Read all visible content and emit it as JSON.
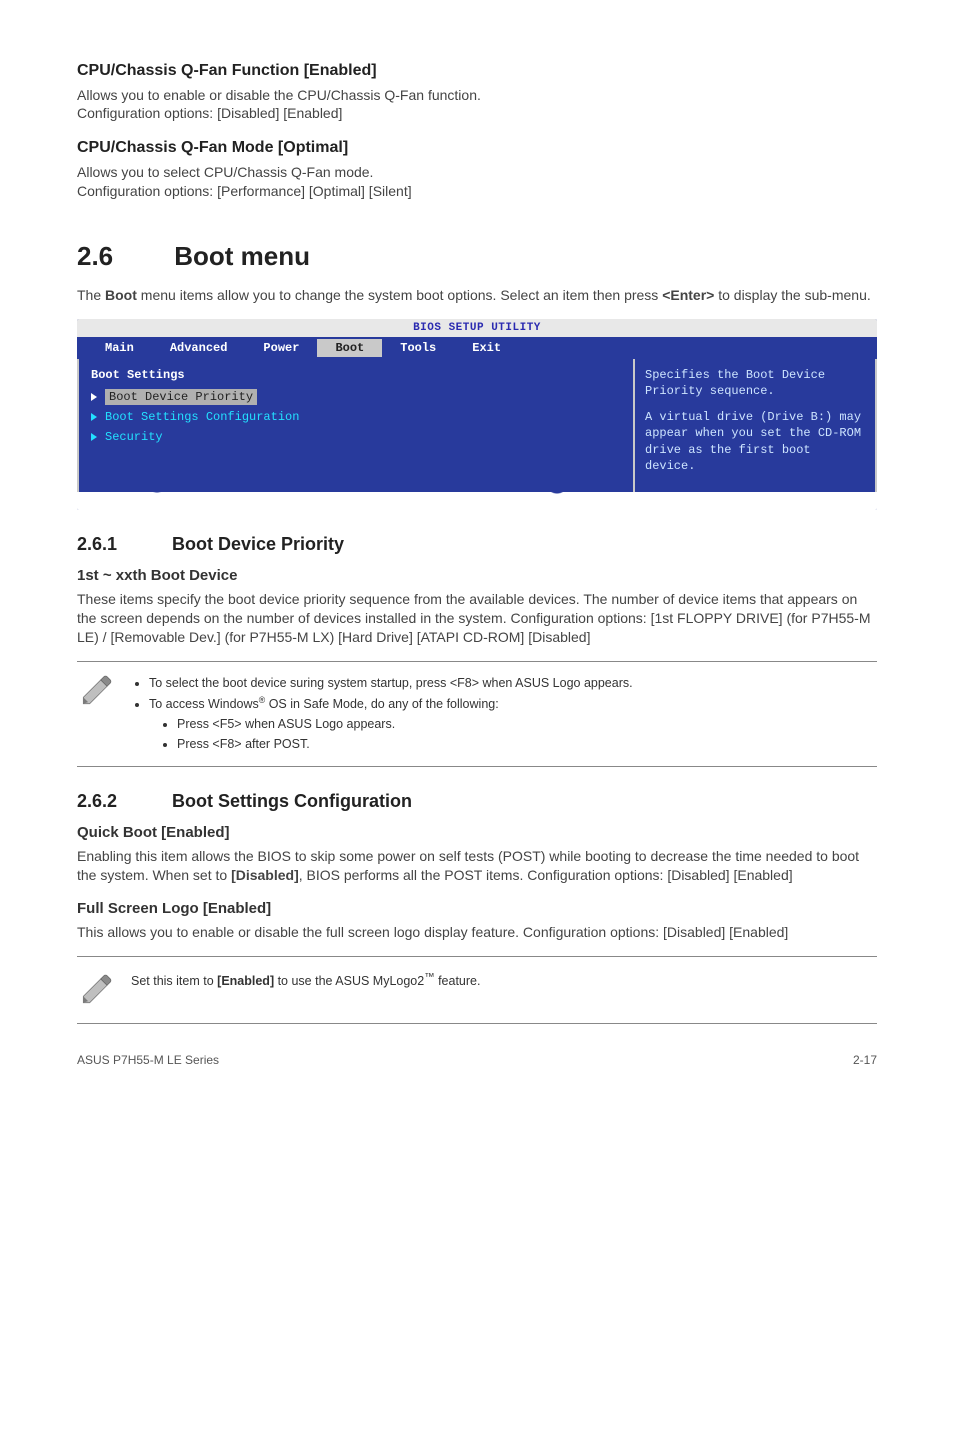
{
  "s1": {
    "h": "CPU/Chassis Q-Fan Function [Enabled]",
    "p1": "Allows you to enable or disable the CPU/Chassis Q-Fan function.",
    "p2": "Configuration options: [Disabled] [Enabled]"
  },
  "s2": {
    "h": "CPU/Chassis Q-Fan Mode [Optimal]",
    "p1": "Allows you to select CPU/Chassis Q-Fan mode.",
    "p2": "Configuration options: [Performance] [Optimal] [Silent]"
  },
  "sec26": {
    "num": "2.6",
    "title": "Boot menu",
    "intro_a": "The ",
    "intro_bold": "Boot",
    "intro_b": " menu items allow you to change the system boot options. Select an item then press ",
    "intro_key": "<Enter>",
    "intro_c": " to display the sub-menu."
  },
  "bios": {
    "title": "BIOS SETUP UTILITY",
    "menu": [
      "Main",
      "Advanced",
      "Power",
      "Boot",
      "Tools",
      "Exit"
    ],
    "active_index": 3,
    "heading": "Boot Settings",
    "items": [
      {
        "label": "Boot Device Priority",
        "selected": true
      },
      {
        "label": "Boot Settings Configuration",
        "selected": false
      },
      {
        "label": "Security",
        "selected": false
      }
    ],
    "right1": "Specifies the Boot Device Priority sequence.",
    "right2": "A virtual drive (Drive B:) may appear when you set the CD-ROM drive as the first boot device."
  },
  "sec261": {
    "num": "2.6.1",
    "title": "Boot Device Priority",
    "h3": "1st ~ xxth Boot Device",
    "p": "These items specify the boot device priority sequence from the available devices. The number of device items that appears on the screen depends on the number of devices installed in the system. Configuration options: [1st FLOPPY DRIVE] (for P7H55-M LE) / [Removable Dev.] (for P7H55-M LX) [Hard Drive] [ATAPI CD-ROM] [Disabled]"
  },
  "note1": {
    "b1": "To select the boot device suring system startup, press <F8> when ASUS Logo appears.",
    "b2a": "To access Windows",
    "b2b": " OS in Safe Mode, do any of the following:",
    "s1": "Press <F5> when ASUS Logo appears.",
    "s2": "Press <F8> after POST."
  },
  "sec262": {
    "num": "2.6.2",
    "title": "Boot Settings Configuration"
  },
  "quick": {
    "h": "Quick Boot [Enabled]",
    "p_a": "Enabling this item allows the BIOS to skip some power on self tests (POST) while booting to decrease the time needed to boot the system. When set to ",
    "p_bold": "[Disabled]",
    "p_b": ", BIOS performs all the POST items. Configuration options: [Disabled] [Enabled]"
  },
  "fslogo": {
    "h": "Full Screen Logo [Enabled]",
    "p": "This allows you to enable or disable the full screen logo display feature. Configuration options: [Disabled] [Enabled]"
  },
  "note2": {
    "a": "Set this item to ",
    "bold": "[Enabled]",
    "b": " to use the ASUS MyLogo2",
    "c": " feature."
  },
  "footer": {
    "left": "ASUS P7H55-M LE Series",
    "right": "2-17"
  }
}
